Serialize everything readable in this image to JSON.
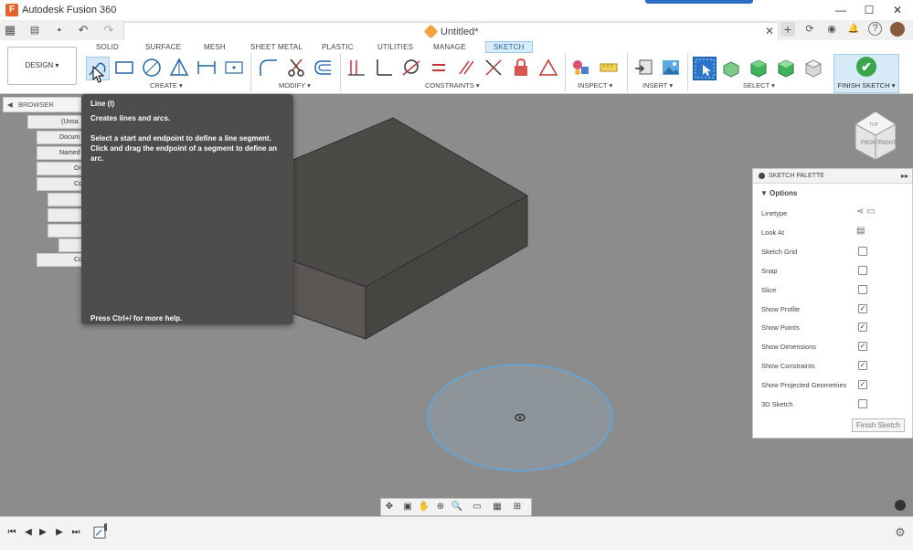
{
  "window": {
    "title": "Autodesk Fusion 360",
    "minimize": "—",
    "maximize": "☐",
    "close": "✕"
  },
  "quick_access": {
    "grid": "▦",
    "file": "▤",
    "save": "▪",
    "undo": "↶",
    "redo": "↷"
  },
  "document_tab": {
    "title": "Untitled*",
    "close": "✕"
  },
  "right_icons": {
    "new_tab": "+",
    "extensions": "⟳",
    "jobs": "◉",
    "notifications": "🔔",
    "help": "?"
  },
  "workspace": {
    "label": "DESIGN ▾"
  },
  "ribbon_tabs": [
    "SOLID",
    "SURFACE",
    "MESH",
    "SHEET METAL",
    "PLASTIC",
    "UTILITIES",
    "MANAGE",
    "SKETCH"
  ],
  "groups": {
    "create": "CREATE ▾",
    "modify": "MODIFY ▾",
    "constraints": "CONSTRAINTS ▾",
    "inspect": "INSPECT ▾",
    "insert": "INSERT ▾",
    "select": "SELECT ▾"
  },
  "finish_sketch": {
    "label": "FINISH SKETCH ▾",
    "icon": "✔"
  },
  "browser": {
    "title": "BROWSER",
    "items": [
      "(Unsa",
      "Docum",
      "Named",
      "Or",
      "Co",
      "",
      "",
      "",
      "",
      "Co"
    ]
  },
  "tooltip": {
    "title": "Line (l)",
    "subtitle": "Creates lines and arcs.",
    "description": "Select a start and endpoint to define a line segment. Click and drag the endpoint of a segment to define an arc.",
    "help": "Press Ctrl+/ for more help."
  },
  "sketch_palette": {
    "title": "SKETCH PALETTE",
    "section": "Options",
    "rows": [
      {
        "label": "Linetype",
        "checked": ""
      },
      {
        "label": "Look At",
        "checked": ""
      },
      {
        "label": "Sketch Grid",
        "checked": ""
      },
      {
        "label": "Snap",
        "checked": ""
      },
      {
        "label": "Slice",
        "checked": ""
      },
      {
        "label": "Show Profile",
        "checked": "✓"
      },
      {
        "label": "Show Points",
        "checked": "✓"
      },
      {
        "label": "Show Dimensions",
        "checked": "✓"
      },
      {
        "label": "Show Constraints",
        "checked": "✓"
      },
      {
        "label": "Show Projected Geometries",
        "checked": "✓"
      },
      {
        "label": "3D Sketch",
        "checked": ""
      }
    ],
    "finish_button": "Finish Sketch"
  },
  "viewcube": {
    "front": "FRONT",
    "right": "RIGHT",
    "top": "TOP"
  },
  "timeline": {
    "first": "⏮",
    "prev": "◀",
    "play": "▶",
    "next": "▶",
    "last": "⏭",
    "settings": "⚙"
  },
  "colors": {
    "accent": "#2b6fc4",
    "viewport_bg": "#8c8c8c",
    "tooltip_bg": "#4d4d4d",
    "circle_fill": "#8d959a",
    "circle_stroke": "#5aa8e6",
    "finish_green": "#3aa64a"
  }
}
